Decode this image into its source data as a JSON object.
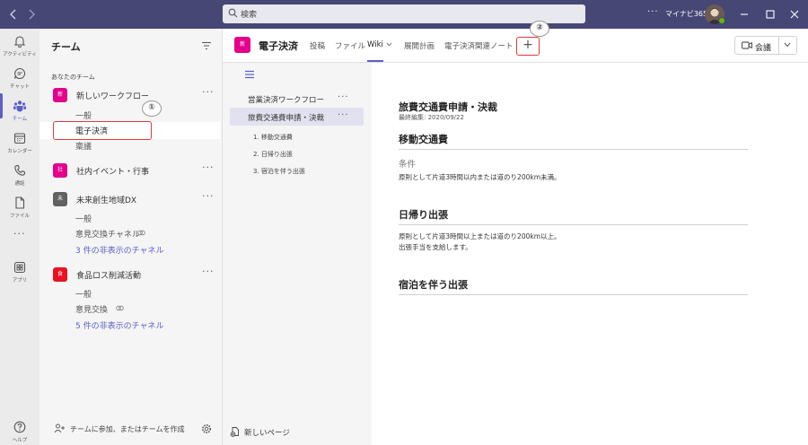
{
  "titlebar": {
    "search_placeholder": "検索",
    "more_label": "···",
    "user_name": "マイナビ365"
  },
  "rail": {
    "items": [
      {
        "label": "アクティビティ",
        "icon": "bell-icon"
      },
      {
        "label": "チャット",
        "icon": "chat-icon"
      },
      {
        "label": "チーム",
        "icon": "teams-icon"
      },
      {
        "label": "カレンダー",
        "icon": "calendar-icon"
      },
      {
        "label": "通話",
        "icon": "phone-icon"
      },
      {
        "label": "ファイル",
        "icon": "file-icon"
      },
      {
        "label": "アプリ",
        "icon": "apps-icon"
      },
      {
        "label": "ヘルプ",
        "icon": "help-icon"
      }
    ],
    "more_label": "···"
  },
  "teams_pane": {
    "title": "チーム",
    "section_label": "あなたのチーム",
    "teams": [
      {
        "initial": "新",
        "color": "#e3008c",
        "name": "新しいワークフロー",
        "channels": [
          "一般",
          "電子決済",
          "稟議"
        ]
      },
      {
        "initial": "社",
        "color": "#e3008c",
        "name": "社内イベント・行事",
        "channels": []
      },
      {
        "initial": "未",
        "color": "#616161",
        "name": "未来創生地域DX",
        "channels": [
          "一般",
          "意見交換チャネル"
        ],
        "hidden": "3 件の非表示のチャネル"
      },
      {
        "initial": "食",
        "color": "#e81123",
        "name": "食品ロス削減活動",
        "channels": [
          "一般",
          "意見交換"
        ],
        "hidden": "5 件の非表示のチャネル"
      }
    ],
    "more_label": "···",
    "join_label": "チームに参加、またはチームを作成"
  },
  "callouts": {
    "one": "①",
    "two": "②"
  },
  "channel_header": {
    "avatar_initial": "新",
    "title": "電子決済",
    "tabs": [
      "投稿",
      "ファイル",
      "Wiki",
      "展開計画",
      "電子決済関連ノート"
    ],
    "active_tab": "Wiki",
    "add_tab_label": "+",
    "meet_label": "会議"
  },
  "wiki_nav": {
    "pages": [
      {
        "title": "営業決済ワークフロー"
      },
      {
        "title": "旅費交通費申請・決裁",
        "selected": true
      }
    ],
    "sections": [
      "1. 移動交通費",
      "2. 日帰り出張",
      "3. 宿泊を伴う出張"
    ],
    "more_label": "···",
    "new_page_label": "新しいページ"
  },
  "wiki_content": {
    "title": "旅費交通費申請・決裁",
    "last_edited": "最終編集: 2020/09/22",
    "sections": [
      {
        "heading": "移動交通費",
        "subheading": "条件",
        "lines": [
          "原則として片道3時間以内または道のり200km未満。"
        ]
      },
      {
        "heading": "日帰り出張",
        "lines": [
          "原則として片道3時間以上または道のり200km以上。",
          "出張手当を支給します。"
        ]
      },
      {
        "heading": "宿泊を伴う出張",
        "lines": []
      }
    ]
  },
  "colors": {
    "accent": "#5b5fc7",
    "titlebar": "#464775",
    "callout": "#e03a3a"
  }
}
